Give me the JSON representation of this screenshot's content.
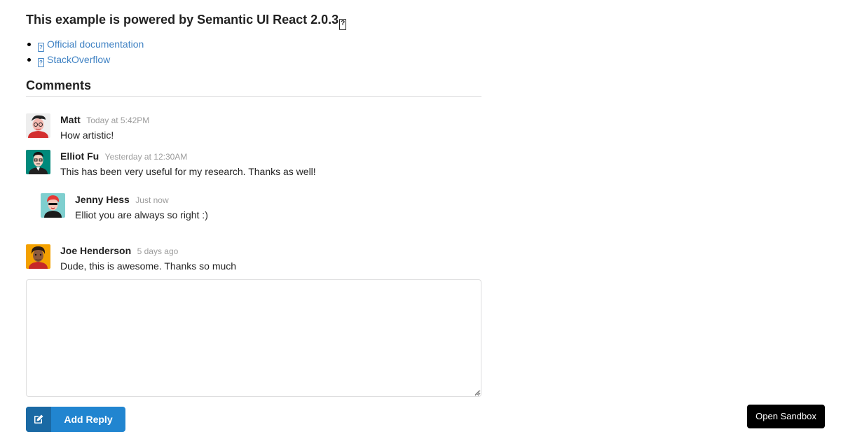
{
  "banner": {
    "title": "This example is powered by Semantic UI React 2.0.3",
    "glyph": "?"
  },
  "links": [
    {
      "label": "Official documentation",
      "icon": "external-link-icon"
    },
    {
      "label": "StackOverflow",
      "icon": "external-link-icon"
    }
  ],
  "comments": {
    "header": "Comments",
    "items": [
      {
        "author": "Matt",
        "time": "Today at 5:42PM",
        "text": "How artistic!",
        "avatar": "avatar-matt"
      },
      {
        "author": "Elliot Fu",
        "time": "Yesterday at 12:30AM",
        "text": "This has been very useful for my research. Thanks as well!",
        "avatar": "avatar-elliot",
        "replies": [
          {
            "author": "Jenny Hess",
            "time": "Just now",
            "text": "Elliot you are always so right :)",
            "avatar": "avatar-jenny"
          }
        ]
      },
      {
        "author": "Joe Henderson",
        "time": "5 days ago",
        "text": "Dude, this is awesome. Thanks so much",
        "avatar": "avatar-joe"
      }
    ]
  },
  "reply_form": {
    "value": "",
    "button_label": "Add Reply",
    "button_icon": "edit-icon"
  },
  "sandbox": {
    "label": "Open Sandbox"
  },
  "colors": {
    "link": "#4183c4",
    "primary": "#2185d0",
    "primary_dark": "#1a69a4"
  }
}
